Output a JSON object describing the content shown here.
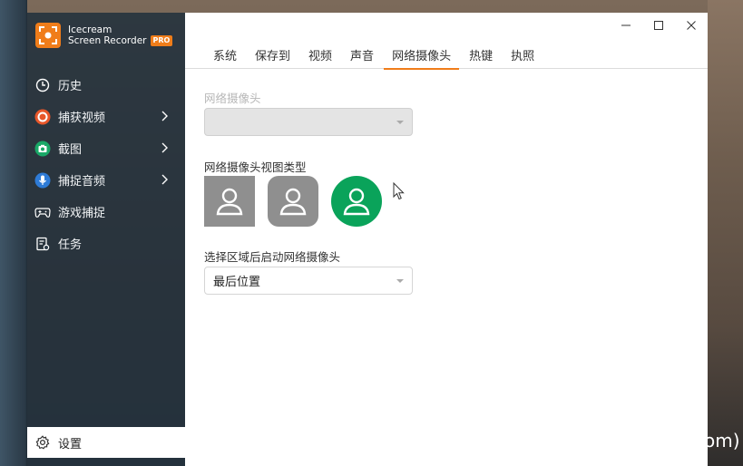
{
  "app": {
    "name_line1": "Icecream",
    "name_line2": "Screen Recorder",
    "badge": "PRO",
    "accent": "#f07d1a"
  },
  "sidebar": {
    "items": [
      {
        "label": "历史",
        "icon": "clock-icon",
        "has_submenu": false
      },
      {
        "label": "捕获视频",
        "icon": "record-icon",
        "has_submenu": true,
        "icon_color": "#e8572a"
      },
      {
        "label": "截图",
        "icon": "camera-icon",
        "has_submenu": true,
        "icon_color": "#1aa867"
      },
      {
        "label": "捕捉音频",
        "icon": "microphone-icon",
        "has_submenu": true,
        "icon_color": "#2e7bd6"
      },
      {
        "label": "游戏捕捉",
        "icon": "gamepad-icon",
        "has_submenu": false
      },
      {
        "label": "任务",
        "icon": "task-icon",
        "has_submenu": false
      }
    ],
    "settings_label": "设置"
  },
  "window_controls": {
    "minimize": "minimize-icon",
    "maximize": "maximize-icon",
    "close": "close-icon"
  },
  "tabs": [
    {
      "label": "系统",
      "active": false
    },
    {
      "label": "保存到",
      "active": false
    },
    {
      "label": "视频",
      "active": false
    },
    {
      "label": "声音",
      "active": false
    },
    {
      "label": "网络摄像头",
      "active": true
    },
    {
      "label": "热键",
      "active": false
    },
    {
      "label": "执照",
      "active": false
    }
  ],
  "webcam": {
    "camera_label": "网络摄像头",
    "camera_value": "",
    "camera_disabled": true,
    "view_type_label": "网络摄像头视图类型",
    "view_types": [
      "square",
      "rounded",
      "circle"
    ],
    "selected_view_type": "circle",
    "start_label": "选择区域后启动网络摄像头",
    "start_value": "最后位置"
  },
  "desktop": {
    "watermark": "om)"
  }
}
